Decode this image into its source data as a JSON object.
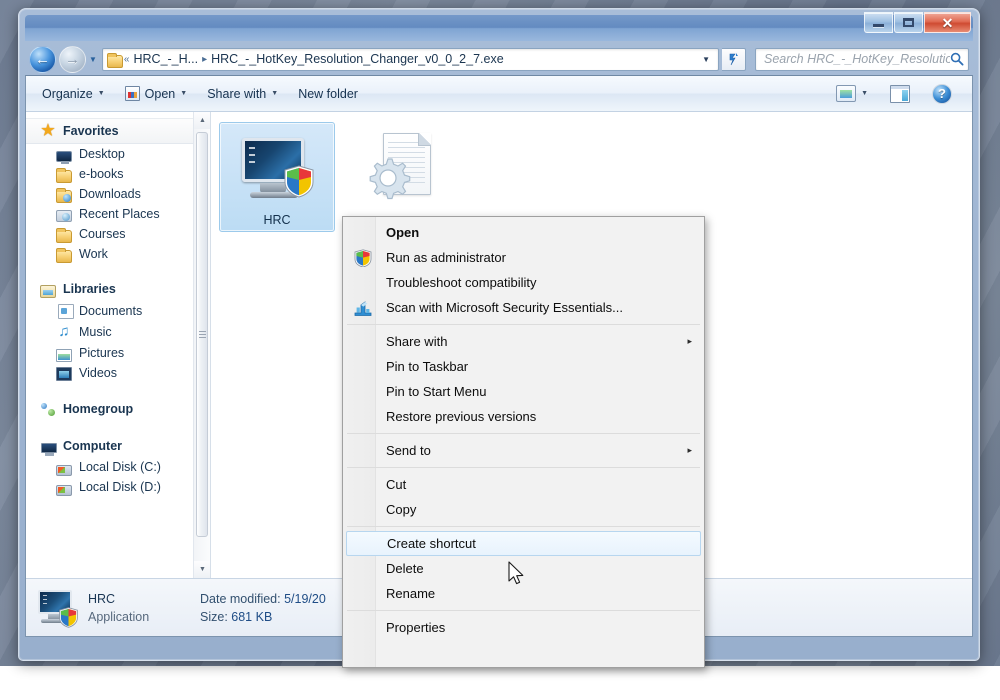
{
  "window": {
    "controls": {
      "minimize": "Minimize",
      "maximize": "Maximize",
      "close": "Close",
      "close_glyph": "✕"
    }
  },
  "nav": {
    "back": "Back",
    "forward": "Forward",
    "recent_dropdown": "Recent pages",
    "refresh": "Refresh",
    "breadcrumb": {
      "overflow": "«",
      "parent": "HRC_-_H...",
      "separator": "▸",
      "current": "HRC_-_HotKey_Resolution_Changer_v0_0_2_7.exe",
      "dropdown": "▼"
    },
    "search": {
      "placeholder": "Search HRC_-_HotKey_Resolution_Ch...",
      "value": "",
      "icon": "search-icon"
    }
  },
  "toolbar": {
    "organize": "Organize",
    "open": "Open",
    "share_with": "Share with",
    "new_folder": "New folder",
    "caret": "▼",
    "view_label": "Change your view",
    "preview_label": "Show the preview pane",
    "help_label": "?"
  },
  "navpane": {
    "groups": [
      {
        "header": {
          "label": "Favorites",
          "icon": "star-icon"
        },
        "items": [
          {
            "label": "Desktop",
            "icon": "desktop-icon"
          },
          {
            "label": "e-books",
            "icon": "folder-icon"
          },
          {
            "label": "Downloads",
            "icon": "downloads-folder-icon"
          },
          {
            "label": "Recent Places",
            "icon": "recent-places-icon"
          },
          {
            "label": "Courses",
            "icon": "folder-icon"
          },
          {
            "label": "Work",
            "icon": "folder-icon"
          }
        ]
      },
      {
        "header": {
          "label": "Libraries",
          "icon": "library-icon"
        },
        "items": [
          {
            "label": "Documents",
            "icon": "documents-icon"
          },
          {
            "label": "Music",
            "icon": "music-icon"
          },
          {
            "label": "Pictures",
            "icon": "pictures-icon"
          },
          {
            "label": "Videos",
            "icon": "videos-icon"
          }
        ]
      },
      {
        "header": {
          "label": "Homegroup",
          "icon": "homegroup-icon"
        },
        "items": []
      },
      {
        "header": {
          "label": "Computer",
          "icon": "computer-icon"
        },
        "items": [
          {
            "label": "Local Disk (C:)",
            "icon": "local-disk-icon"
          },
          {
            "label": "Local Disk (D:)",
            "icon": "local-disk-icon"
          }
        ]
      }
    ],
    "scrollbar": {
      "up": "▲",
      "down": "▼"
    }
  },
  "content": {
    "items": [
      {
        "label": "HRC",
        "icon": "application-exe-icon",
        "selected": true
      },
      {
        "label": "",
        "icon": "configuration-file-icon",
        "selected": false
      }
    ]
  },
  "details": {
    "icon": "application-exe-icon",
    "name": "HRC",
    "type": "Application",
    "date_modified_label": "Date modified:",
    "date_modified_value": "5/19/20",
    "size_label": "Size:",
    "size_value": "681 KB"
  },
  "context_menu": {
    "items": [
      {
        "label": "Open",
        "bold": true,
        "icon": null,
        "submenu": false,
        "hover": false,
        "separator_after": false
      },
      {
        "label": "Run as administrator",
        "bold": false,
        "icon": "uac-shield-icon",
        "submenu": false,
        "hover": false,
        "separator_after": false
      },
      {
        "label": "Troubleshoot compatibility",
        "bold": false,
        "icon": null,
        "submenu": false,
        "hover": false,
        "separator_after": false
      },
      {
        "label": "Scan with Microsoft Security Essentials...",
        "bold": false,
        "icon": "security-essentials-icon",
        "submenu": false,
        "hover": false,
        "separator_after": true
      },
      {
        "label": "Share with",
        "bold": false,
        "icon": null,
        "submenu": true,
        "hover": false,
        "separator_after": false
      },
      {
        "label": "Pin to Taskbar",
        "bold": false,
        "icon": null,
        "submenu": false,
        "hover": false,
        "separator_after": false
      },
      {
        "label": "Pin to Start Menu",
        "bold": false,
        "icon": null,
        "submenu": false,
        "hover": false,
        "separator_after": false
      },
      {
        "label": "Restore previous versions",
        "bold": false,
        "icon": null,
        "submenu": false,
        "hover": false,
        "separator_after": true
      },
      {
        "label": "Send to",
        "bold": false,
        "icon": null,
        "submenu": true,
        "hover": false,
        "separator_after": true
      },
      {
        "label": "Cut",
        "bold": false,
        "icon": null,
        "submenu": false,
        "hover": false,
        "separator_after": false
      },
      {
        "label": "Copy",
        "bold": false,
        "icon": null,
        "submenu": false,
        "hover": false,
        "separator_after": true
      },
      {
        "label": "Create shortcut",
        "bold": false,
        "icon": null,
        "submenu": false,
        "hover": true,
        "separator_after": false
      },
      {
        "label": "Delete",
        "bold": false,
        "icon": null,
        "submenu": false,
        "hover": false,
        "separator_after": false
      },
      {
        "label": "Rename",
        "bold": false,
        "icon": null,
        "submenu": false,
        "hover": false,
        "separator_after": true
      },
      {
        "label": "Properties",
        "bold": false,
        "icon": null,
        "submenu": false,
        "hover": false,
        "separator_after": false
      }
    ],
    "submenu_arrow": "▸"
  },
  "colors": {
    "selection_blue": "#bcdcf4",
    "hover_blue": "#e8f3fd",
    "title_blue": "#5c85be",
    "close_red": "#cf4b32",
    "menu_bg": "#f2f2f2"
  }
}
